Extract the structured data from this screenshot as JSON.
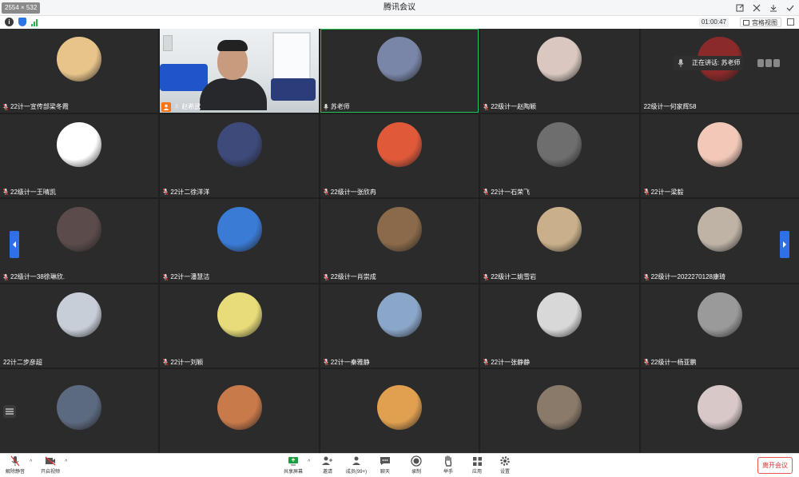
{
  "window": {
    "title": "腾讯会议",
    "resolution_badge": "2554 × 532"
  },
  "infobar": {
    "timer": "01:00:47",
    "view_label": "宫格视图"
  },
  "active_speaker": {
    "label": "正在讲话: 苏老师"
  },
  "participants": [
    {
      "name": "22计一宣传部梁冬霞",
      "mic": "muted",
      "avatar_color": "#e8c48a"
    },
    {
      "name": "赵希武",
      "mic": "on",
      "host": true,
      "video": true
    },
    {
      "name": "苏老师",
      "mic": "on",
      "speaking": true,
      "avatar_color": "#7a86a8"
    },
    {
      "name": "22级计一赵陶颖",
      "mic": "muted",
      "avatar_color": "#d9c7c0"
    },
    {
      "name": "22级计一何家辉58",
      "mic": "none",
      "avatar_color": "#8a2a2a"
    },
    {
      "name": "22级计一王晴凯",
      "mic": "muted",
      "avatar_color": "#ffffff"
    },
    {
      "name": "22计二徐洋洋",
      "mic": "muted",
      "avatar_color": "#3d4a7a"
    },
    {
      "name": "22级计一张欣冉",
      "mic": "muted",
      "avatar_color": "#e05a3a"
    },
    {
      "name": "22计一石荣飞",
      "mic": "muted",
      "avatar_color": "#6e6e6e"
    },
    {
      "name": "22计一梁毅",
      "mic": "muted",
      "avatar_color": "#f2c9b8"
    },
    {
      "name": "22级计一38徐琳欣.",
      "mic": "muted",
      "avatar_color": "#5b4b4b"
    },
    {
      "name": "22计一潘慧洁",
      "mic": "muted",
      "avatar_color": "#3a7bd5"
    },
    {
      "name": "22级计一肖崇成",
      "mic": "muted",
      "avatar_color": "#8a6a4a"
    },
    {
      "name": "22级计二姚雪岩",
      "mic": "muted",
      "avatar_color": "#c9b08a"
    },
    {
      "name": "22级计一2022270128康琦",
      "mic": "muted",
      "avatar_color": "#bfb3a6"
    },
    {
      "name": "22计二步彦超",
      "mic": "none",
      "avatar_color": "#c8ced8"
    },
    {
      "name": "22计一刘颖",
      "mic": "muted",
      "avatar_color": "#e8dc7a"
    },
    {
      "name": "22计一秦雅静",
      "mic": "muted",
      "avatar_color": "#8aa6c9"
    },
    {
      "name": "22计一张静静",
      "mic": "muted",
      "avatar_color": "#d8d8d8"
    },
    {
      "name": "22级计一杨亚鹏",
      "mic": "muted",
      "avatar_color": "#9a9a9a"
    },
    {
      "name": "",
      "mic": "none",
      "avatar_color": "#5c6a80"
    },
    {
      "name": "",
      "mic": "none",
      "avatar_color": "#c97a4a"
    },
    {
      "name": "",
      "mic": "none",
      "avatar_color": "#e0a050"
    },
    {
      "name": "",
      "mic": "none",
      "avatar_color": "#8a7a6a"
    },
    {
      "name": "",
      "mic": "none",
      "avatar_color": "#d8c8c8"
    }
  ],
  "toolbar": {
    "unmute": "解除静音",
    "start_video": "开启视频",
    "share_screen": "共享屏幕",
    "invite": "邀请",
    "members": "成员(99+)",
    "chat": "聊天",
    "record": "录制",
    "raise_hand": "举手",
    "apps": "应用",
    "settings": "设置",
    "leave": "离开会议"
  },
  "colors": {
    "accent": "#2f6fe8",
    "speaking": "#22c55e",
    "host": "#f97316",
    "leave": "#dd3333"
  }
}
